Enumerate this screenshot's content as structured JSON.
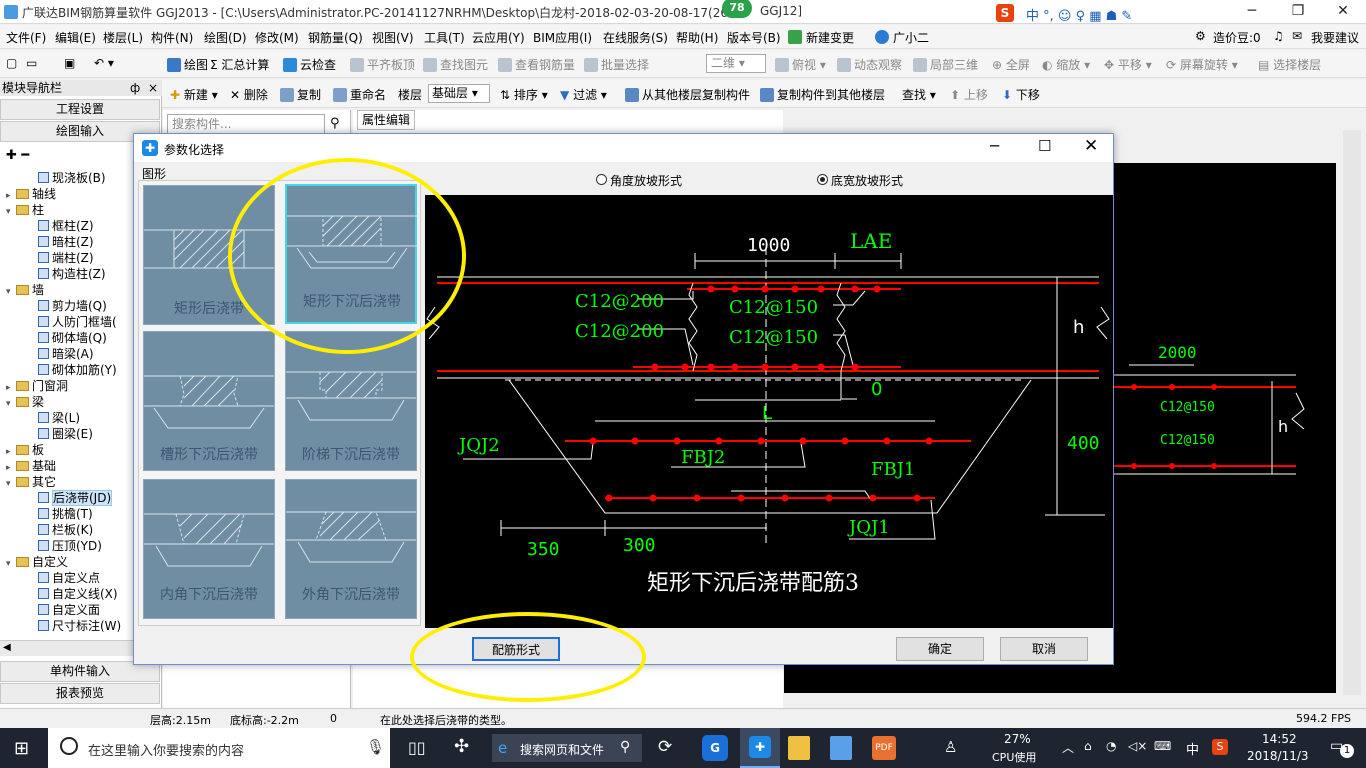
{
  "window": {
    "title": "广联达BIM钢筋算量软件 GGJ2013 - [C:\\Users\\Administrator.PC-20141127NRHM\\Desktop\\白龙村-2018-02-03-20-08-17(260",
    "title_suffix": "GGJ12]",
    "badge": "78"
  },
  "menu": [
    "文件(F)",
    "编辑(E)",
    "楼层(L)",
    "构件(N)",
    "绘图(D)",
    "修改(M)",
    "钢筋量(Q)",
    "视图(V)",
    "工具(T)",
    "云应用(Y)",
    "BIM应用(I)",
    "在线服务(S)",
    "帮助(H)",
    "版本号(B)",
    "新建变更",
    "广小二"
  ],
  "menu_right": {
    "cost": "造价豆:0",
    "suggest": "我要建议"
  },
  "toolbar1": [
    "绘图",
    "汇总计算",
    "云检查",
    "平齐板顶",
    "查找图元",
    "查看钢筋量",
    "批量选择",
    "二维",
    "俯视",
    "动态观察",
    "局部三维",
    "全屏",
    "缩放",
    "平移",
    "屏幕旋转",
    "选择楼层"
  ],
  "toolbar2": [
    "新建",
    "删除",
    "复制",
    "重命名",
    "楼层",
    "基础层",
    "排序",
    "过滤",
    "从其他楼层复制构件",
    "复制构件到其他楼层",
    "查找",
    "上移",
    "下移"
  ],
  "nav": {
    "header": "模块导航栏",
    "pin": "ф",
    "close": "×",
    "buttons": [
      "工程设置",
      "绘图输入"
    ],
    "bottom_buttons": [
      "单构件输入",
      "报表预览"
    ],
    "tree": [
      {
        "label": "现浇板(B)",
        "type": "leaf",
        "indent": 3
      },
      {
        "label": "轴线",
        "type": "folder",
        "indent": 1
      },
      {
        "label": "柱",
        "type": "folder",
        "indent": 1,
        "open": true
      },
      {
        "label": "框柱(Z)",
        "type": "leaf",
        "indent": 3
      },
      {
        "label": "暗柱(Z)",
        "type": "leaf",
        "indent": 3
      },
      {
        "label": "端柱(Z)",
        "type": "leaf",
        "indent": 3
      },
      {
        "label": "构造柱(Z)",
        "type": "leaf",
        "indent": 3
      },
      {
        "label": "墙",
        "type": "folder",
        "indent": 1,
        "open": true
      },
      {
        "label": "剪力墙(Q)",
        "type": "leaf",
        "indent": 3
      },
      {
        "label": "人防门框墙(",
        "type": "leaf",
        "indent": 3
      },
      {
        "label": "砌体墙(Q)",
        "type": "leaf",
        "indent": 3
      },
      {
        "label": "暗梁(A)",
        "type": "leaf",
        "indent": 3
      },
      {
        "label": "砌体加筋(Y)",
        "type": "leaf",
        "indent": 3
      },
      {
        "label": "门窗洞",
        "type": "folder",
        "indent": 1
      },
      {
        "label": "梁",
        "type": "folder",
        "indent": 1,
        "open": true
      },
      {
        "label": "梁(L)",
        "type": "leaf",
        "indent": 3
      },
      {
        "label": "圈梁(E)",
        "type": "leaf",
        "indent": 3
      },
      {
        "label": "板",
        "type": "folder",
        "indent": 1
      },
      {
        "label": "基础",
        "type": "folder",
        "indent": 1
      },
      {
        "label": "其它",
        "type": "folder",
        "indent": 1,
        "open": true
      },
      {
        "label": "后浇带(JD)",
        "type": "leaf",
        "indent": 3,
        "selected": true
      },
      {
        "label": "挑檐(T)",
        "type": "leaf",
        "indent": 3
      },
      {
        "label": "栏板(K)",
        "type": "leaf",
        "indent": 3
      },
      {
        "label": "压顶(YD)",
        "type": "leaf",
        "indent": 3
      },
      {
        "label": "自定义",
        "type": "folder",
        "indent": 1,
        "open": true
      },
      {
        "label": "自定义点",
        "type": "leaf",
        "indent": 3
      },
      {
        "label": "自定义线(X)",
        "type": "leaf",
        "indent": 3
      },
      {
        "label": "自定义面",
        "type": "leaf",
        "indent": 3
      },
      {
        "label": "尺寸标注(W)",
        "type": "leaf",
        "indent": 3
      }
    ]
  },
  "search": {
    "placeholder": "搜索构件..."
  },
  "prop_tab": "属性编辑",
  "dialog": {
    "title": "参数化选择",
    "group_label": "图形",
    "radio_angle": "角度放坡形式",
    "radio_bottom": "底宽放坡形式",
    "thumbs": [
      "矩形后浇带",
      "矩形下沉后浇带",
      "槽形下沉后浇带",
      "阶梯下沉后浇带",
      "内角下沉后浇带",
      "外角下沉后浇带"
    ],
    "rebar_button": "配筋形式",
    "ok": "确定",
    "cancel": "取消"
  },
  "cad": {
    "dim_1000": "1000",
    "lae": "LAE",
    "c12_200_a": "C12@200",
    "c12_150_a": "C12@150",
    "c12_200_b": "C12@200",
    "c12_150_b": "C12@150",
    "h": "h",
    "zero": "0",
    "L": "L",
    "jqj2": "JQJ2",
    "fbj2": "FBJ2",
    "fbj1": "FBJ1",
    "dim_400": "400",
    "jqj1": "JQJ1",
    "dim_350": "350",
    "dim_300": "300",
    "caption": "矩形下沉后浇带配筋3"
  },
  "bg_cad": {
    "dim_2000": "2000",
    "c12_150_a": "C12@150",
    "c12_150_b": "C12@150",
    "h": "h"
  },
  "status": {
    "floor_h": "层高:2.15m",
    "bottom": "底标高:-2.2m",
    "zero": "0",
    "hint": "在此处选择后浇带的类型。",
    "fps": "594.2 FPS"
  },
  "taskbar": {
    "search": "在这里输入你要搜索的内容",
    "browser_search": "搜索网页和文件",
    "cpu_pct": "27%",
    "cpu_label": "CPU使用",
    "ime": "中",
    "time": "14:52",
    "date": "2018/11/3",
    "notif": "1"
  },
  "colors": {
    "accent": "#0078d7",
    "rebar": "#ff0000",
    "label_green": "#00ff00",
    "highlight": "#ffee00"
  }
}
